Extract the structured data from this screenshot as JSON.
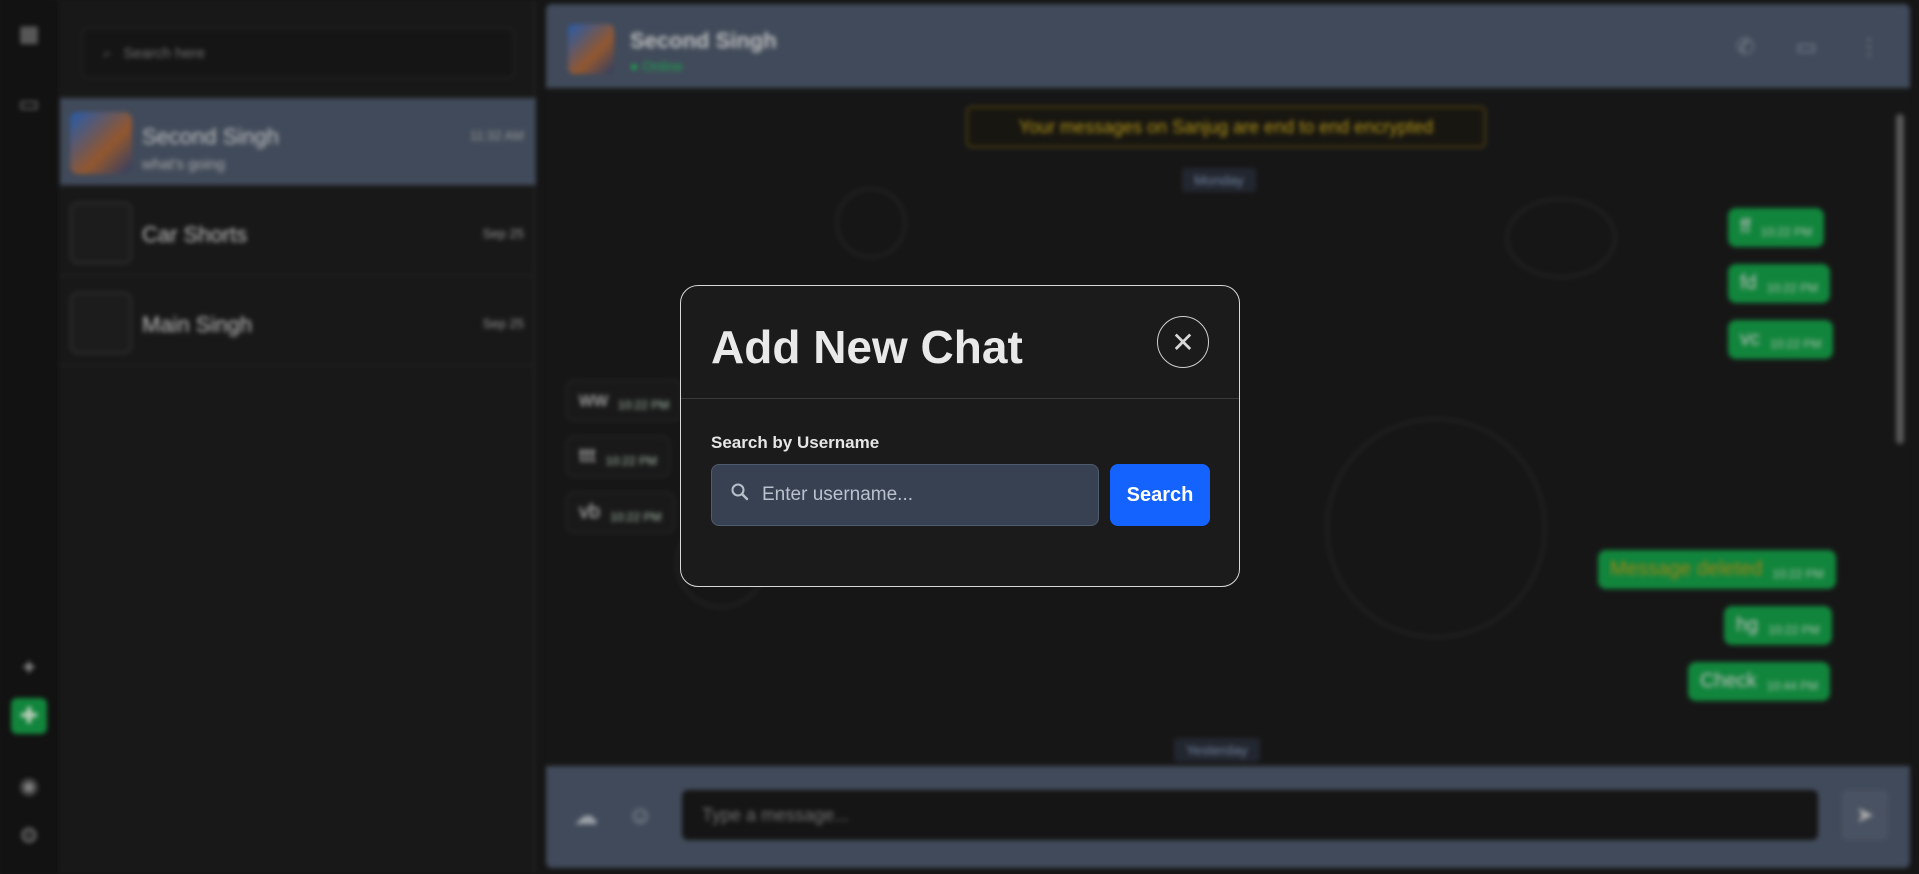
{
  "sidebar": {
    "search_placeholder": "Search here",
    "chats": [
      {
        "name": "Second Singh",
        "preview": "what's going",
        "time": "11:32 AM",
        "active": true
      },
      {
        "name": "Car Shorts",
        "preview": "",
        "time": "Sep 25",
        "active": false
      },
      {
        "name": "Main Singh",
        "preview": "",
        "time": "Sep 25",
        "active": false
      }
    ]
  },
  "conversation": {
    "contact_name": "Second Singh",
    "contact_status": "Online",
    "encryption_notice": "Your messages on Sanjug are end to end encrypted",
    "day_labels": [
      "Monday",
      "Yesterday"
    ],
    "messages": [
      {
        "dir": "out",
        "text": "ff",
        "time": "10:22 PM"
      },
      {
        "dir": "out",
        "text": "fd",
        "time": "10:22 PM"
      },
      {
        "dir": "out",
        "text": "vc",
        "time": "10:22 PM"
      },
      {
        "dir": "in",
        "text": "ww",
        "time": "10:22 PM"
      },
      {
        "dir": "in",
        "text": "ttt",
        "time": "10:22 PM"
      },
      {
        "dir": "in",
        "text": "vb",
        "time": "10:22 PM"
      },
      {
        "dir": "out",
        "text": "Message deleted",
        "time": "10:22 PM"
      },
      {
        "dir": "out",
        "text": "hg",
        "time": "10:22 PM"
      },
      {
        "dir": "out",
        "text": "Check",
        "time": "10:44 PM"
      }
    ],
    "composer_placeholder": "Type a message..."
  },
  "modal": {
    "title": "Add New Chat",
    "field_label": "Search by Username",
    "input_placeholder": "Enter username...",
    "input_value": "",
    "search_label": "Search",
    "close_glyph": "✕"
  },
  "icons": {
    "accent_green": "#16a34a",
    "accent_blue": "#1463ff",
    "header_bg": "#4f5b6e"
  }
}
